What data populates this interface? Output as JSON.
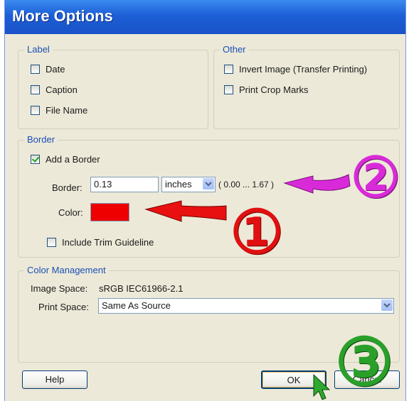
{
  "window": {
    "title": "More Options"
  },
  "label_group": {
    "legend": "Label",
    "items": [
      {
        "label": "Date",
        "checked": false
      },
      {
        "label": "Caption",
        "checked": false
      },
      {
        "label": "File Name",
        "checked": false
      }
    ]
  },
  "other_group": {
    "legend": "Other",
    "items": [
      {
        "label": "Invert Image (Transfer Printing)",
        "checked": false
      },
      {
        "label": "Print Crop Marks",
        "checked": false
      }
    ]
  },
  "border_group": {
    "legend": "Border",
    "add_border": {
      "label": "Add a Border",
      "checked": true
    },
    "border_label": "Border:",
    "border_value": "0.13",
    "unit": "inches",
    "range": "( 0.00 ... 1.67 )",
    "color_label": "Color:",
    "color_value": "#ee0000",
    "trim": {
      "label": "Include Trim Guideline",
      "checked": false
    }
  },
  "color_mgmt": {
    "legend": "Color Management",
    "image_space_label": "Image Space:",
    "image_space_value": "sRGB IEC61966-2.1",
    "print_space_label": "Print Space:",
    "print_space_value": "Same As Source"
  },
  "buttons": {
    "help": "Help",
    "ok": "OK",
    "cancel": "Cancel"
  },
  "annotations": {
    "one": "①",
    "two": "②",
    "three": "③"
  },
  "colors": {
    "annot_one": "#e01010",
    "annot_two": "#e030e0",
    "annot_three": "#2aa02a"
  }
}
